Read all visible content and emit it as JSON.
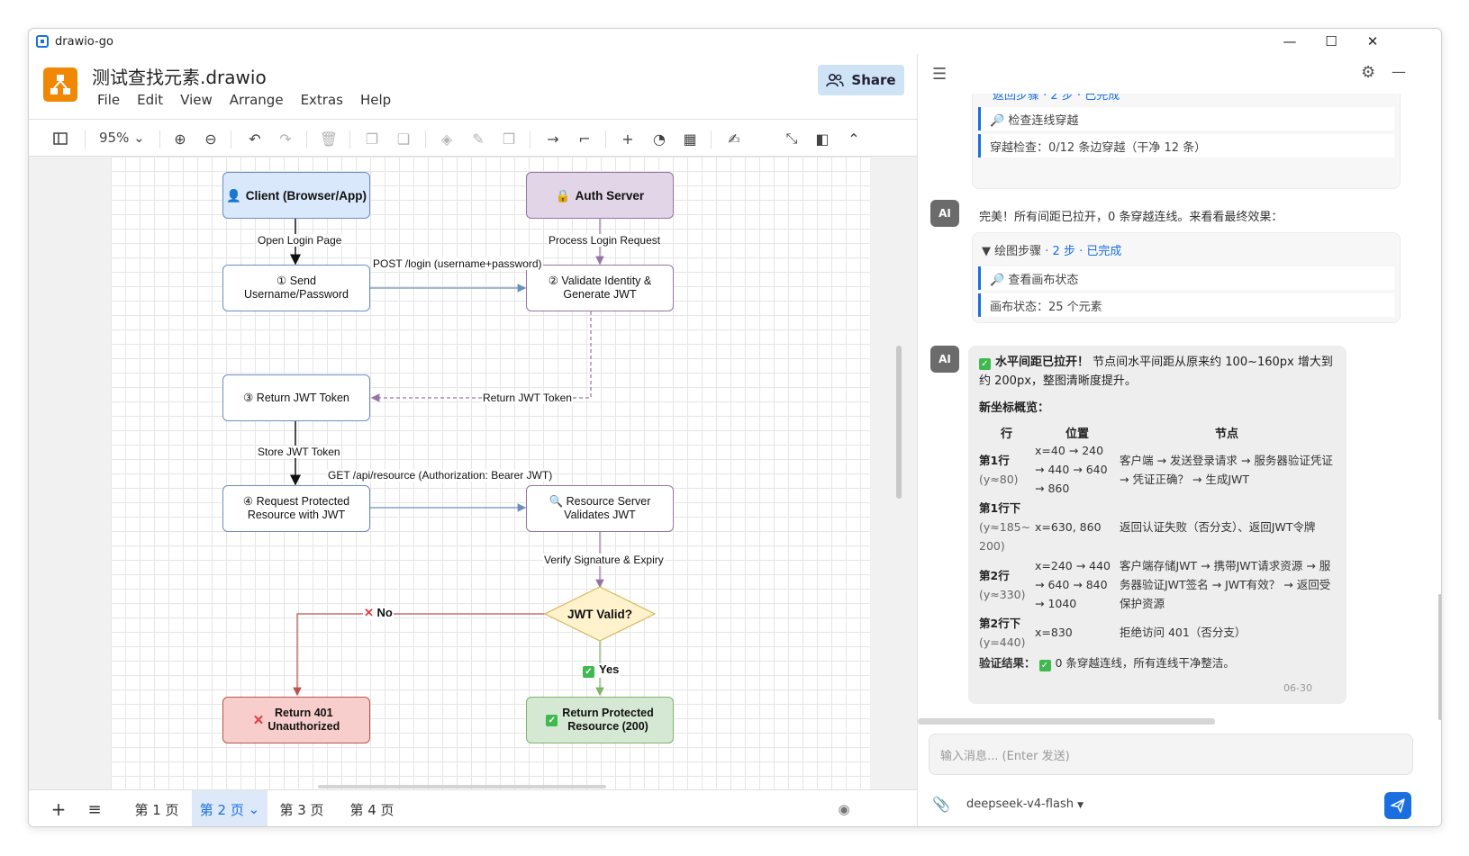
{
  "window": {
    "title": "drawio-go"
  },
  "app": {
    "doc_title": "测试查找元素.drawio",
    "menu": [
      "File",
      "Edit",
      "View",
      "Arrange",
      "Extras",
      "Help"
    ],
    "share_label": "Share",
    "zoom": "95%"
  },
  "diagram": {
    "nodes": {
      "client": "Client (Browser/App)",
      "auth": "Auth Server",
      "send": "① Send\nUsername/Password",
      "validate": "② Validate Identity &\nGenerate JWT",
      "return_token": "③ Return JWT Token",
      "request": "④ Request Protected\nResource with JWT",
      "resource_server": "Resource Server\nValidates JWT",
      "jwt_valid": "JWT Valid?",
      "return401": "Return 401\nUnauthorized",
      "return200": "Return Protected\nResource (200)"
    },
    "edges": {
      "open_login": "Open Login Page",
      "process_login": "Process Login Request",
      "post_login": "POST /login (username+password)",
      "return_jwt": "Return JWT Token",
      "store_jwt": "Store JWT Token",
      "get_resource": "GET /api/resource (Authorization: Bearer JWT)",
      "verify": "Verify Signature & Expiry",
      "no": "No",
      "yes": "Yes"
    },
    "colors": {
      "client_fill": "#dae8fc",
      "client_stroke": "#6c8ebf",
      "auth_fill": "#e1d5e7",
      "auth_stroke": "#9673a6",
      "diamond_fill": "#fff2cc",
      "diamond_stroke": "#d6b656",
      "error_fill": "#f8cecc",
      "error_stroke": "#b85450",
      "success_fill": "#d5e8d4",
      "success_stroke": "#82b366"
    }
  },
  "pages": [
    "第 1 页",
    "第 2 页",
    "第 3 页",
    "第 4 页"
  ],
  "active_page": "第 2 页",
  "chat": {
    "card1": {
      "top_partial": "返回步骤 · 2 步 · 已完成",
      "step1": "🔎 检查连线穿越",
      "step2": "穿越检查：0/12 条边穿越（干净 12 条）"
    },
    "msg1": "完美！所有间距已拉开，0 条穿越连线。来看看最终效果：",
    "card2": {
      "header": "▼ 绘图步骤",
      "header_meta": "· 2 步 · 已完成",
      "step1": "🔎 查看画布状态",
      "step2": "画布状态：25 个元素"
    },
    "msg2": {
      "lead_bold": "水平间距已拉开！",
      "lead_rest": "节点间水平间距从原来约 100~160px 增大到约 200px，整图清晰度提升。",
      "section": "新坐标概览：",
      "headers": [
        "行",
        "位置",
        "节点"
      ],
      "rows": [
        {
          "row": "第1行",
          "sub": "(y≈80)",
          "pos": "x=40 → 240 → 440 → 640 → 860",
          "nodes": "客户端 → 发送登录请求 → 服务器验证凭证 → 凭证正确？ → 生成JWT"
        },
        {
          "row": "第1行下",
          "sub": "(y≈185~200)",
          "pos": "x=630, 860",
          "nodes": "返回认证失败（否分支）、返回JWT令牌"
        },
        {
          "row": "第2行",
          "sub": "(y≈330)",
          "pos": "x=240 → 440 → 640 → 840 → 1040",
          "nodes": "客户端存储JWT → 携带JWT请求资源 → 服务器验证JWT签名 → JWT有效？ → 返回受保护资源"
        },
        {
          "row": "第2行下",
          "sub": "(y=440)",
          "pos": "x=830",
          "nodes": "拒绝访问 401（否分支）"
        }
      ],
      "verify_label": "验证结果：",
      "verify_text": "0 条穿越连线，所有连线干净整洁。",
      "time": "06-30"
    },
    "input_placeholder": "输入消息... (Enter 发送)",
    "model": "deepseek-v4-flash"
  }
}
